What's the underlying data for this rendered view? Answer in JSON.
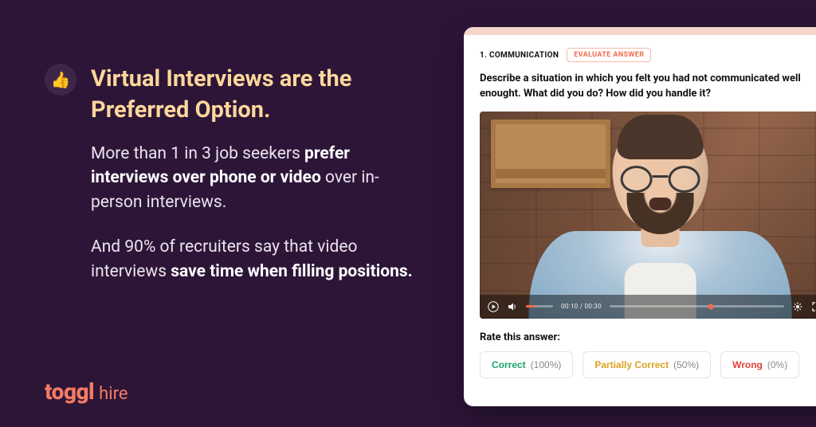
{
  "headline": "Virtual Interviews are the Preferred Option.",
  "body": {
    "p1_a": "More than 1 in 3 job seekers ",
    "p1_b": "prefer interviews over phone or video",
    "p1_c": " over in-person interviews.",
    "p2_a": "And 90% of recruiters say that video interviews ",
    "p2_b": "save time when filling positions."
  },
  "logo": {
    "brand": "toggl",
    "product": "hire"
  },
  "icon_glyph": "👍",
  "card": {
    "index_label": "1. COMMUNICATION",
    "evaluate_label": "EVALUATE ANSWER",
    "question": "Describe a situation in which you felt you had not communicated well enought. What did you do? How did you handle it?",
    "timecode": "00:10 / 00:30",
    "rate_label": "Rate this answer:",
    "ratings": {
      "correct": {
        "label": "Correct",
        "pct": "(100%)"
      },
      "partial": {
        "label": "Partially Correct",
        "pct": "(50%)"
      },
      "wrong": {
        "label": "Wrong",
        "pct": "(0%)"
      }
    }
  }
}
